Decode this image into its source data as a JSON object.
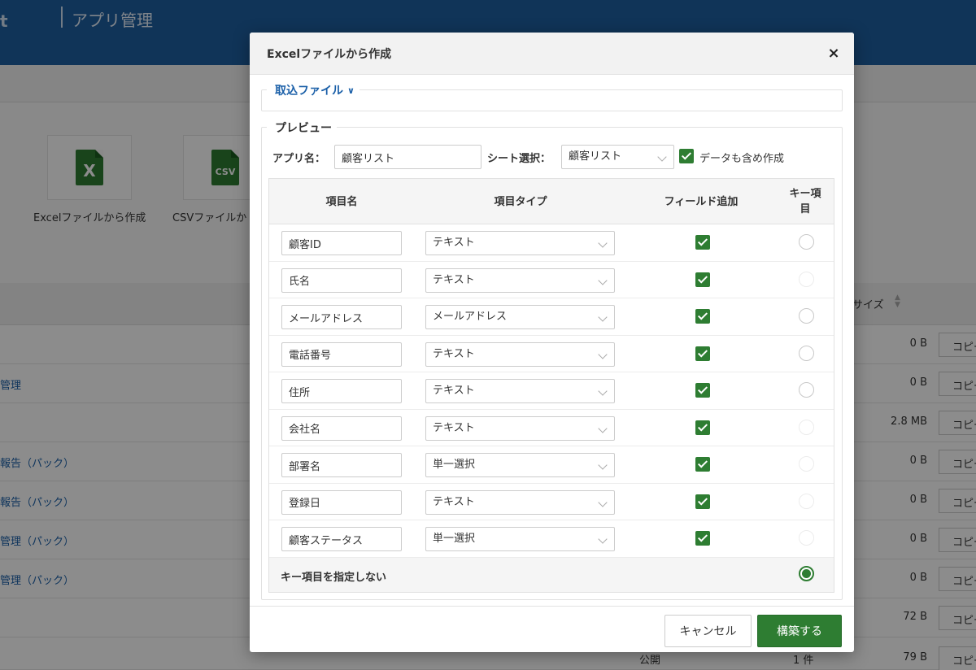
{
  "background": {
    "logo_fragment": "t",
    "app_title": "アプリ管理",
    "tiles": [
      {
        "label": "Excelファイルから作成",
        "icon_text": "X"
      },
      {
        "label": "CSVファイルか",
        "icon_text": "CSV"
      }
    ],
    "size_header": "サイズ",
    "rows": [
      {
        "link": "",
        "size": "0 B",
        "copy": "コピー"
      },
      {
        "link": "管理",
        "size": "0 B",
        "copy": "コピー"
      },
      {
        "link": "",
        "size": "2.8 MB",
        "copy": "コピー"
      },
      {
        "link": "報告（パック）",
        "size": "0 B",
        "copy": "コピー"
      },
      {
        "link": "報告（パック）",
        "size": "0 B",
        "copy": "コピー"
      },
      {
        "link": "管理（パック）",
        "size": "0 B",
        "copy": "コピー"
      },
      {
        "link": "管理（パック）",
        "size": "0 B",
        "copy": "コピー"
      },
      {
        "link": "",
        "size": "72 B",
        "copy": "コピー"
      },
      {
        "link": "",
        "status": "公開",
        "count": "1 件",
        "size": "79 B",
        "copy": "コピー"
      }
    ]
  },
  "modal": {
    "title": "Excelファイルから作成",
    "close_label": "×",
    "import_legend": "取込ファイル",
    "preview_legend": "プレビュー",
    "app_name_label": "アプリ名：",
    "app_name_value": "顧客リスト",
    "sheet_label": "シート選択：",
    "sheet_value": "顧客リスト",
    "include_data_label": "データも含め作成",
    "include_data_checked": true,
    "columns": {
      "name": "項目名",
      "type": "項目タイプ",
      "add_field": "フィールド追加",
      "key_line1": "キー項",
      "key_line2": "目"
    },
    "fields": [
      {
        "name": "顧客ID",
        "type": "テキスト",
        "add": true,
        "key": "empty"
      },
      {
        "name": "氏名",
        "type": "テキスト",
        "add": true,
        "key": "faint"
      },
      {
        "name": "メールアドレス",
        "type": "メールアドレス",
        "add": true,
        "key": "empty"
      },
      {
        "name": "電話番号",
        "type": "テキスト",
        "add": true,
        "key": "empty"
      },
      {
        "name": "住所",
        "type": "テキスト",
        "add": true,
        "key": "empty"
      },
      {
        "name": "会社名",
        "type": "テキスト",
        "add": true,
        "key": "faint"
      },
      {
        "name": "部署名",
        "type": "単一選択",
        "add": true,
        "key": "faint"
      },
      {
        "name": "登録日",
        "type": "テキスト",
        "add": true,
        "key": "faint"
      },
      {
        "name": "顧客ステータス",
        "type": "単一選択",
        "add": true,
        "key": "faint"
      }
    ],
    "no_key_label": "キー項目を指定しない",
    "no_key_selected": true,
    "cancel_label": "キャンセル",
    "build_label": "構築する",
    "colors": {
      "accent_green": "#2e7d32",
      "link_blue": "#1a5fa8",
      "header_blue": "#1e5fa0"
    }
  }
}
